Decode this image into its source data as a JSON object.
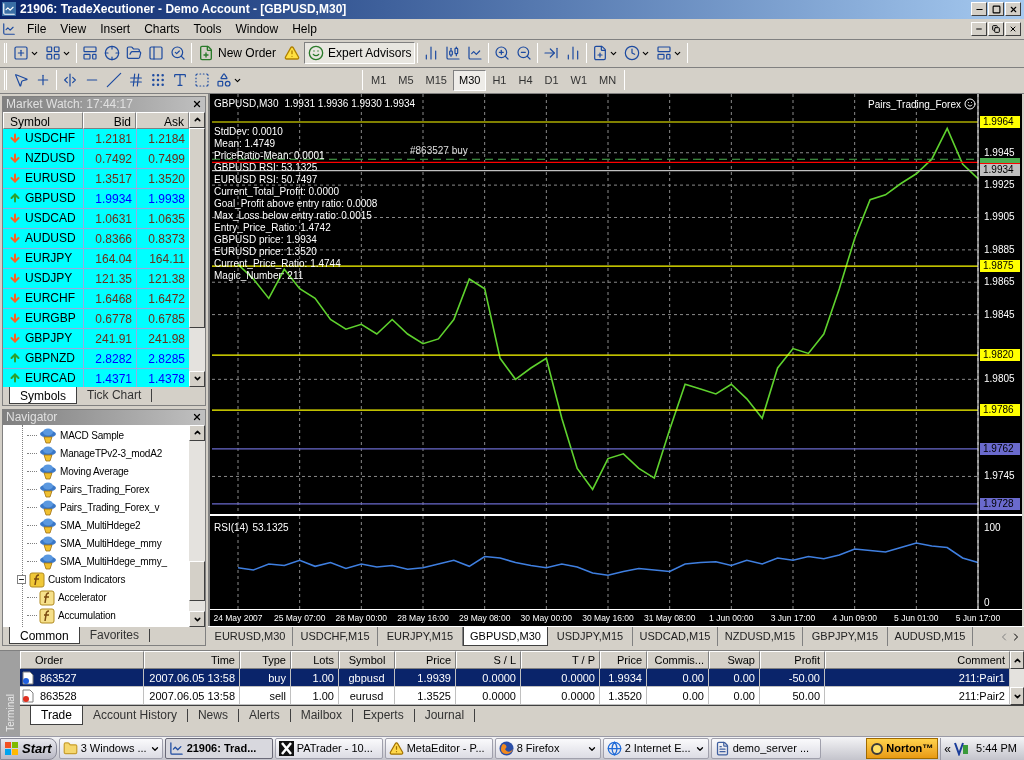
{
  "window": {
    "title": "21906: TradeXecutioner - Demo Account - [GBPUSD,M30]"
  },
  "menu": [
    "File",
    "View",
    "Insert",
    "Charts",
    "Tools",
    "Window",
    "Help"
  ],
  "toolbar": {
    "buttons": [
      {
        "label": "New Order",
        "on": false
      },
      {
        "label": "Expert Advisors",
        "on": true
      }
    ]
  },
  "timeframes": [
    {
      "label": "M1",
      "selected": false
    },
    {
      "label": "M5",
      "selected": false
    },
    {
      "label": "M15",
      "selected": false
    },
    {
      "label": "M30",
      "selected": true
    },
    {
      "label": "H1",
      "selected": false
    },
    {
      "label": "H4",
      "selected": false
    },
    {
      "label": "D1",
      "selected": false
    },
    {
      "label": "W1",
      "selected": false
    },
    {
      "label": "MN",
      "selected": false
    }
  ],
  "market_watch": {
    "title": "Market Watch: 17:44:17",
    "columns": [
      "Symbol",
      "Bid",
      "Ask"
    ],
    "rows": [
      {
        "symbol": "USDCHF",
        "bid": "1.2181",
        "ask": "1.2184",
        "rising": false
      },
      {
        "symbol": "NZDUSD",
        "bid": "0.7492",
        "ask": "0.7499",
        "rising": false
      },
      {
        "symbol": "EURUSD",
        "bid": "1.3517",
        "ask": "1.3520",
        "rising": false
      },
      {
        "symbol": "GBPUSD",
        "bid": "1.9934",
        "ask": "1.9938",
        "rising": true
      },
      {
        "symbol": "USDCAD",
        "bid": "1.0631",
        "ask": "1.0635",
        "rising": false
      },
      {
        "symbol": "AUDUSD",
        "bid": "0.8366",
        "ask": "0.8373",
        "rising": false
      },
      {
        "symbol": "EURJPY",
        "bid": "164.04",
        "ask": "164.11",
        "rising": false
      },
      {
        "symbol": "USDJPY",
        "bid": "121.35",
        "ask": "121.38",
        "rising": false
      },
      {
        "symbol": "EURCHF",
        "bid": "1.6468",
        "ask": "1.6472",
        "rising": false
      },
      {
        "symbol": "EURGBP",
        "bid": "0.6778",
        "ask": "0.6785",
        "rising": false
      },
      {
        "symbol": "GBPJPY",
        "bid": "241.91",
        "ask": "241.98",
        "rising": false
      },
      {
        "symbol": "GBPNZD",
        "bid": "2.8282",
        "ask": "2.8285",
        "rising": true
      },
      {
        "symbol": "EURCAD",
        "bid": "1.4371",
        "ask": "1.4378",
        "rising": true
      }
    ],
    "tabs": [
      {
        "label": "Symbols",
        "selected": true
      },
      {
        "label": "Tick Chart",
        "selected": false
      }
    ]
  },
  "navigator": {
    "title": "Navigator",
    "items": [
      {
        "label": "MACD Sample",
        "kind": "expert"
      },
      {
        "label": "ManageTPv2-3_modA2",
        "kind": "expert"
      },
      {
        "label": "Moving Average",
        "kind": "expert"
      },
      {
        "label": "Pairs_Trading_Forex",
        "kind": "expert"
      },
      {
        "label": "Pairs_Trading_Forex_v",
        "kind": "expert"
      },
      {
        "label": "SMA_MultiHdege2",
        "kind": "expert"
      },
      {
        "label": "SMA_MultiHdege_mmy",
        "kind": "expert"
      },
      {
        "label": "SMA_MultiHdege_mmy_",
        "kind": "expert"
      },
      {
        "label": "Custom Indicators",
        "kind": "folder",
        "expanded": true,
        "children": [
          {
            "label": "Accelerator",
            "kind": "indicator"
          },
          {
            "label": "Accumulation",
            "kind": "indicator"
          }
        ]
      }
    ],
    "tabs": [
      {
        "label": "Common",
        "selected": true
      },
      {
        "label": "Favorites",
        "selected": false
      }
    ]
  },
  "chart": {
    "symbol": "GBPUSD,M30",
    "header": "1.9931 1.9936 1.9930 1.9934",
    "expert": "Pairs_Trading_Forex",
    "comment_lines": [
      "StdDev: 0.0010",
      "Mean: 1.4749",
      "PriceRatio-Mean: 0.0001",
      "GBPUSD RSI: 53.1325",
      "EURUSD RSI: 50.7497",
      "Current_Total_Profit: 0.0000",
      "Goal_Profit above entry ratio: 0.0008",
      "Max_Loss below entry ratio: 0.0015",
      "Entry_Price_Ratio: 1.4742",
      "GBPUSD price: 1.9934",
      "EURUSD price: 1.3520",
      "Current_Price_Ratio: 1.4744",
      "Magic_Number: 211"
    ],
    "chart_data": {
      "type": "line",
      "grid": true,
      "ylim": [
        1.97218,
        1.99813
      ],
      "yticks": [
        1.9945,
        1.9925,
        1.9905,
        1.9885,
        1.9865,
        1.9845,
        1.9805,
        1.9745
      ],
      "series": [
        {
          "color": "#5fd22e",
          "values": [
            1.9876,
            1.9867,
            1.9855,
            1.9873,
            1.9861,
            1.9855,
            1.9842,
            1.9836,
            1.9839,
            1.9833,
            1.9842,
            1.9833,
            1.9827,
            1.983,
            1.9842,
            1.9867,
            1.9861,
            1.9818,
            1.9805,
            1.9812,
            1.9818,
            1.9781,
            1.975,
            1.9737,
            1.9756,
            1.9759,
            1.975,
            1.9744,
            1.9774,
            1.9802,
            1.9799,
            1.9796,
            1.9802,
            1.9793,
            1.9781,
            1.9812,
            1.9824,
            1.9821,
            1.9833,
            1.9861,
            1.9892,
            1.9916,
            1.9919,
            1.9926,
            1.9932,
            1.9941,
            1.996,
            1.9938,
            1.9929
          ]
        }
      ],
      "ref_lines": [
        {
          "axis": "y",
          "value": 1.9964,
          "label": "1.9964",
          "color": "#ffff00"
        },
        {
          "axis": "y",
          "value": 1.9939,
          "color": "#ff0000"
        },
        {
          "axis": "y",
          "value": 1.9941,
          "color": "#4caf50"
        },
        {
          "axis": "y",
          "value": 1.9934,
          "label": "1.9934",
          "color": "#c0c0c0"
        },
        {
          "axis": "y",
          "value": 1.9875,
          "label": "1.9875",
          "color": "#ffff00"
        },
        {
          "axis": "y",
          "value": 1.982,
          "label": "1.9820",
          "color": "#ffff00"
        },
        {
          "axis": "y",
          "value": 1.9786,
          "label": "1.9786",
          "color": "#ffff00"
        },
        {
          "axis": "y",
          "value": 1.9762,
          "label": "1.9762",
          "color": "#6a6acd"
        },
        {
          "axis": "y",
          "value": 1.9728,
          "label": "1.9728",
          "color": "#6a6acd"
        }
      ],
      "annotations": [
        {
          "text": "#863527 buy",
          "y": 1.9941
        }
      ]
    }
  },
  "indicator": {
    "value": "53.1325",
    "chart_data": {
      "type": "line",
      "grid": true,
      "ylim": [
        -10,
        114
      ],
      "yticks": [
        0,
        100
      ],
      "categories": [
        "24 May 2007",
        null,
        null,
        null,
        "25 May 07:00",
        null,
        null,
        null,
        "28 May 00:00",
        null,
        null,
        null,
        "28 May 16:00",
        null,
        null,
        null,
        "29 May 08:00",
        null,
        null,
        null,
        "30 May 00:00",
        null,
        null,
        null,
        "30 May 16:00",
        null,
        null,
        null,
        "31 May 08:00",
        null,
        null,
        null,
        "1 Jun 00:00",
        null,
        null,
        null,
        "3 Jun 17:00",
        null,
        null,
        null,
        "4 Jun 09:00",
        null,
        null,
        null,
        "5 Jun 01:00",
        null,
        null,
        null,
        "5 Jun 17:00"
      ],
      "series": [
        {
          "name": "RSI(14)",
          "color": "#3f7fe0",
          "values": [
            45,
            42,
            50,
            48,
            55,
            47,
            52,
            44,
            50,
            46,
            48,
            43,
            45,
            50,
            55,
            47,
            60,
            58,
            52,
            48,
            45,
            50,
            46,
            38,
            35,
            40,
            44,
            42,
            40,
            50,
            52,
            53,
            48,
            55,
            50,
            58,
            55,
            60,
            57,
            62,
            70,
            68,
            66,
            72,
            78,
            74,
            72,
            58,
            52
          ]
        }
      ]
    }
  },
  "chart_tabs": [
    {
      "label": "EURUSD,M30",
      "selected": false
    },
    {
      "label": "USDCHF,M15",
      "selected": false
    },
    {
      "label": "EURJPY,M15",
      "selected": false
    },
    {
      "label": "GBPUSD,M30",
      "selected": true
    },
    {
      "label": "USDJPY,M15",
      "selected": false
    },
    {
      "label": "USDCAD,M15",
      "selected": false
    },
    {
      "label": "NZDUSD,M15",
      "selected": false
    },
    {
      "label": "GBPJPY,M15",
      "selected": false
    },
    {
      "label": "AUDUSD,M15",
      "selected": false
    }
  ],
  "terminal": {
    "label": "Terminal",
    "columns": [
      "Order",
      "Time",
      "Type",
      "Lots",
      "Symbol",
      "Price",
      "S / L",
      "T / P",
      "Price",
      "Commis...",
      "Swap",
      "Profit",
      "Comment"
    ],
    "rows": [
      {
        "kind": "buy",
        "selected": true,
        "cells": [
          "863527",
          "2007.06.05 13:58",
          "buy",
          "1.00",
          "gbpusd",
          "1.9939",
          "0.0000",
          "0.0000",
          "1.9934",
          "0.00",
          "0.00",
          "-50.00",
          "211:Pair1"
        ]
      },
      {
        "kind": "sell",
        "selected": false,
        "cells": [
          "863528",
          "2007.06.05 13:58",
          "sell",
          "1.00",
          "eurusd",
          "1.3525",
          "0.0000",
          "0.0000",
          "1.3520",
          "0.00",
          "0.00",
          "50.00",
          "211:Pair2"
        ]
      }
    ],
    "tabs": [
      {
        "label": "Trade",
        "selected": true
      },
      {
        "label": "Account History",
        "selected": false
      },
      {
        "label": "News",
        "selected": false
      },
      {
        "label": "Alerts",
        "selected": false
      },
      {
        "label": "Mailbox",
        "selected": false
      },
      {
        "label": "Experts",
        "selected": false
      },
      {
        "label": "Journal",
        "selected": false
      }
    ]
  },
  "taskbar": {
    "start": "Start",
    "items": [
      {
        "label": "3 Windows ...",
        "kind": "folder",
        "selected": false,
        "dropdown": true
      },
      {
        "label": "21906: Trad...",
        "kind": "chart",
        "selected": true,
        "dropdown": false
      },
      {
        "label": "PATrader - 10...",
        "kind": "x",
        "selected": false,
        "dropdown": false
      },
      {
        "label": "MetaEditor - P...",
        "kind": "warning",
        "selected": false,
        "dropdown": false
      },
      {
        "label": "8 Firefox",
        "kind": "browser",
        "selected": false,
        "dropdown": true
      },
      {
        "label": "2 Internet E...",
        "kind": "globe",
        "selected": false,
        "dropdown": true
      },
      {
        "label": "demo_server ...",
        "kind": "document",
        "selected": false,
        "dropdown": false
      }
    ],
    "norton": "Norton™",
    "chevron": "«",
    "clock": "5:44 PM"
  }
}
